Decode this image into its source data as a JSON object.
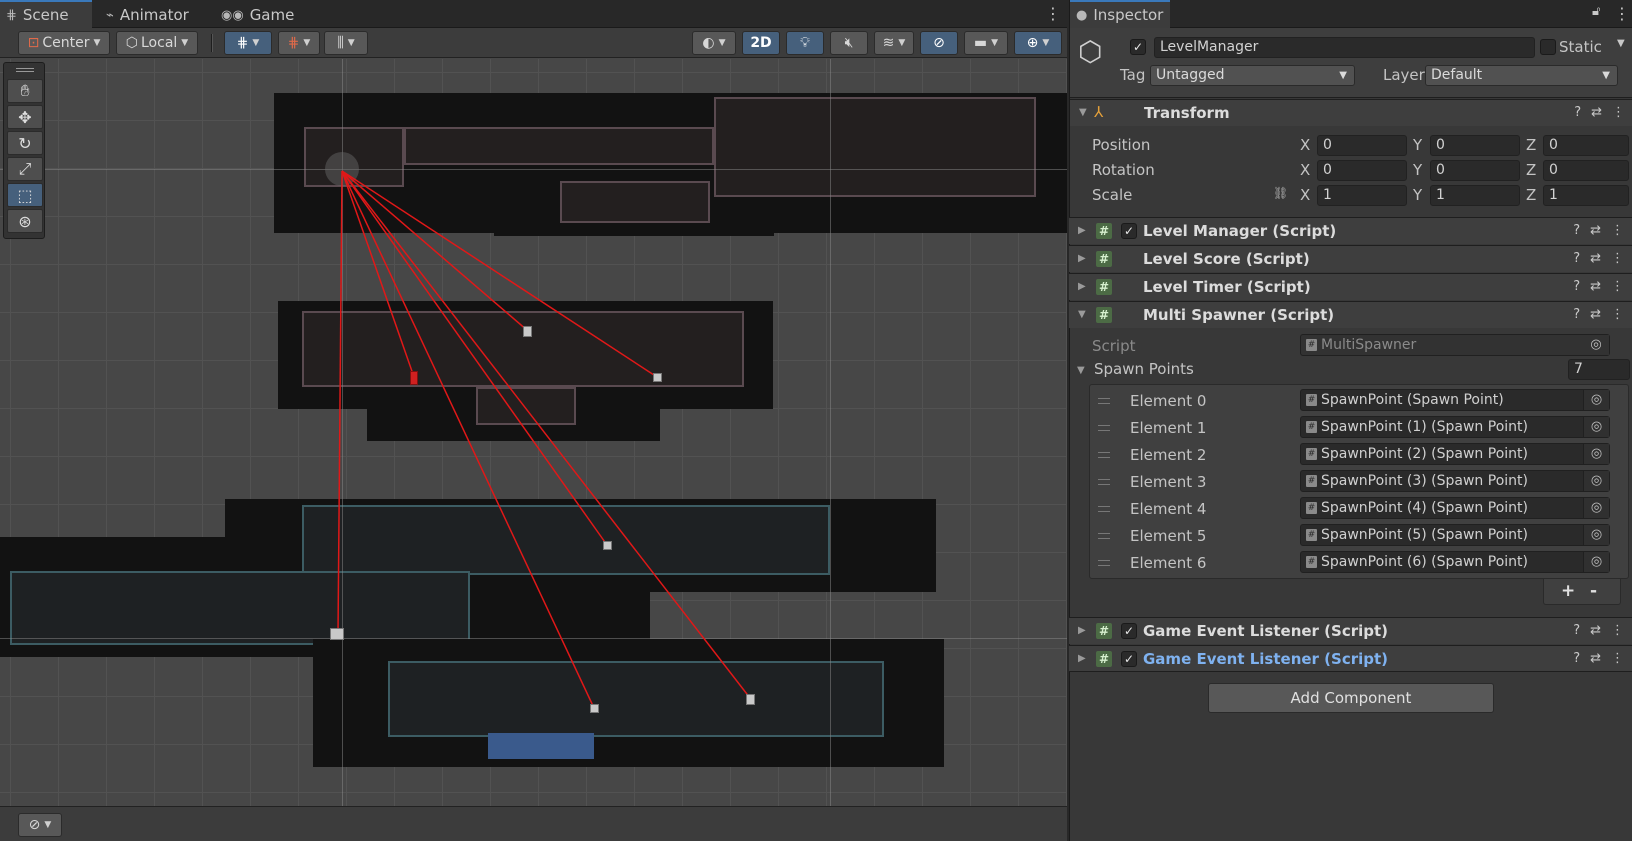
{
  "scene_tabs": [
    {
      "label": "Scene",
      "icon": "grid-icon"
    },
    {
      "label": "Animator",
      "icon": "animator-icon"
    },
    {
      "label": "Game",
      "icon": "gamepad-icon"
    }
  ],
  "scene_toolbar": {
    "pivot_mode": "Center",
    "pivot_rotation": "Local",
    "mode_2d": "2D"
  },
  "inspector": {
    "tab_label": "Inspector",
    "object_name": "LevelManager",
    "active": true,
    "static_label": "Static",
    "static": false,
    "tag_label": "Tag",
    "tag_value": "Untagged",
    "layer_label": "Layer",
    "layer_value": "Default",
    "transform": {
      "title": "Transform",
      "rows": [
        {
          "label": "Position",
          "x": "0",
          "y": "0",
          "z": "0"
        },
        {
          "label": "Rotation",
          "x": "0",
          "y": "0",
          "z": "0"
        },
        {
          "label": "Scale",
          "x": "1",
          "y": "1",
          "z": "1"
        }
      ],
      "axis_labels": [
        "X",
        "Y",
        "Z"
      ]
    },
    "components": [
      {
        "title": "Level Manager (Script)",
        "checkbox": true
      },
      {
        "title": "Level Score (Script)",
        "checkbox": false
      },
      {
        "title": "Level Timer (Script)",
        "checkbox": false
      }
    ],
    "multi_spawner": {
      "title": "Multi Spawner (Script)",
      "script_label": "Script",
      "script_value": "MultiSpawner",
      "spawn_points_label": "Spawn Points",
      "spawn_points_count": "7",
      "elements": [
        {
          "label": "Element 0",
          "value": "SpawnPoint (Spawn Point)"
        },
        {
          "label": "Element 1",
          "value": "SpawnPoint (1) (Spawn Point)"
        },
        {
          "label": "Element 2",
          "value": "SpawnPoint (2) (Spawn Point)"
        },
        {
          "label": "Element 3",
          "value": "SpawnPoint (3) (Spawn Point)"
        },
        {
          "label": "Element 4",
          "value": "SpawnPoint (4) (Spawn Point)"
        },
        {
          "label": "Element 5",
          "value": "SpawnPoint (5) (Spawn Point)"
        },
        {
          "label": "Element 6",
          "value": "SpawnPoint (6) (Spawn Point)"
        }
      ],
      "add_label": "+",
      "remove_label": "-"
    },
    "event_listeners": [
      {
        "title": "Game Event Listener (Script)",
        "checkbox": true
      },
      {
        "title": "Game Event Listener (Script)",
        "checkbox": true
      }
    ],
    "add_component_label": "Add Component"
  },
  "colors": {
    "accent_blue": "#3a79bb",
    "link_red": "#e01818",
    "selected_title": "#7fb2f0"
  }
}
